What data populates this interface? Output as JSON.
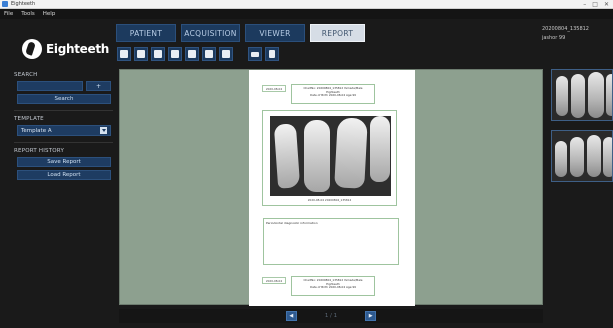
{
  "window": {
    "title": "Eighteeth"
  },
  "menu": [
    "File",
    "Tools",
    "Help"
  ],
  "logo": {
    "text": "Eighteeth"
  },
  "tabs": [
    {
      "label": "PATIENT",
      "active": false
    },
    {
      "label": "ACQUISITION",
      "active": false
    },
    {
      "label": "VIEWER",
      "active": false
    },
    {
      "label": "REPORT",
      "active": true
    }
  ],
  "patient_info": {
    "id": "20200804_135812",
    "name": "jashor 99"
  },
  "toolbar": {
    "icons": [
      "layout-1-icon",
      "layout-2-icon",
      "layout-3-icon",
      "layout-4-icon",
      "layout-5-icon",
      "add-page-icon",
      "remove-page-icon",
      "single-view-icon",
      "split-view-icon"
    ]
  },
  "sidebar": {
    "search_label": "SEARCH",
    "search_value": "",
    "search_plus": "+",
    "search_button": "Search",
    "template_label": "TEMPLATE",
    "template_value": "Template A",
    "history_label": "REPORT HISTORY",
    "save_button": "Save Report",
    "load_button": "Load Report"
  },
  "report": {
    "header_date": "2020-08-04",
    "header_line1": "ChartNo: 20200804_135812  Yamade/Male",
    "header_line2": "Eighteeth",
    "header_line3": "Date of Birth 2020-08-04 Age:99",
    "xray_caption": "2020-08-04 20200804_135812",
    "notes_title": "Periodontal diagnostic information",
    "footer_date": "2020-08-04",
    "footer_line1": "ChartNo: 20200804_135812  Yamade/Male",
    "footer_line2": "Eighteeth",
    "footer_line3": "Date of Birth 2020-08-04 Age:99"
  },
  "pager": {
    "prev": "◀",
    "text": "1 / 1",
    "next": "▶"
  }
}
